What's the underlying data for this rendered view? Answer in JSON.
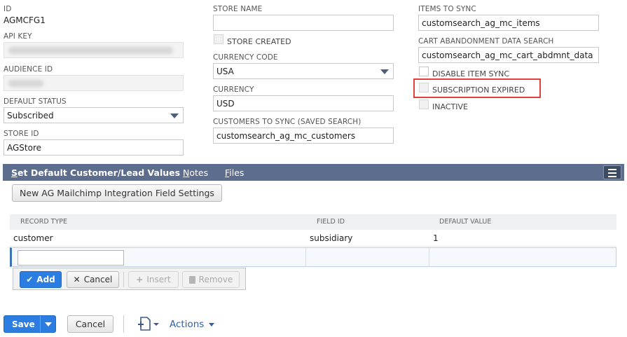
{
  "col1": {
    "id_label": "ID",
    "id_value": "AGMCFG1",
    "api_key_label": "API KEY",
    "audience_id_label": "AUDIENCE ID",
    "default_status_label": "DEFAULT STATUS",
    "default_status_value": "Subscribed",
    "store_id_label": "STORE ID",
    "store_id_value": "AGStore"
  },
  "col2": {
    "store_name_label": "STORE NAME",
    "store_name_value": "",
    "store_created_label": "STORE CREATED",
    "currency_code_label": "CURRENCY CODE",
    "currency_code_value": "USA",
    "currency_label": "CURRENCY",
    "currency_value": "USD",
    "customers_to_sync_label": "CUSTOMERS TO SYNC (SAVED SEARCH)",
    "customers_to_sync_value": "customsearch_ag_mc_customers"
  },
  "col3": {
    "items_to_sync_label": "ITEMS TO SYNC",
    "items_to_sync_value": "customsearch_ag_mc_items",
    "cart_abandonment_label": "CART ABANDONMENT DATA SEARCH",
    "cart_abandonment_value": "customsearch_ag_mc_cart_abdmnt_data",
    "disable_item_sync_label": "DISABLE ITEM SYNC",
    "subscription_expired_label": "SUBSCRIPTION EXPIRED",
    "inactive_label": "INACTIVE"
  },
  "tabs": {
    "t1_first": "S",
    "t1_rest": "et Default Customer/Lead Values",
    "t2_first": "N",
    "t2_rest": "otes",
    "t3_first": "F",
    "t3_rest": "iles"
  },
  "sublist": {
    "new_button": "New AG Mailchimp Integration Field Settings",
    "columns": [
      "RECORD TYPE",
      "FIELD ID",
      "DEFAULT VALUE"
    ],
    "rows": [
      [
        "customer",
        "subsidiary",
        "1"
      ]
    ],
    "add_label": "Add",
    "cancel_label": "Cancel",
    "insert_label": "Insert",
    "remove_label": "Remove"
  },
  "footer": {
    "save_label": "Save",
    "cancel_label": "Cancel",
    "actions_label": "Actions"
  },
  "colors": {
    "tab_bar": "#5d6d8e",
    "primary_button": "#2b7de1",
    "highlight_box": "#e0413c"
  },
  "icons": {
    "select_arrow": "chevron-down-icon",
    "add": "checkmark-icon",
    "cancel": "x-icon",
    "insert": "plus-icon",
    "remove": "trash-icon",
    "new_record": "new-document-icon",
    "tab_menu": "menu-icon"
  }
}
